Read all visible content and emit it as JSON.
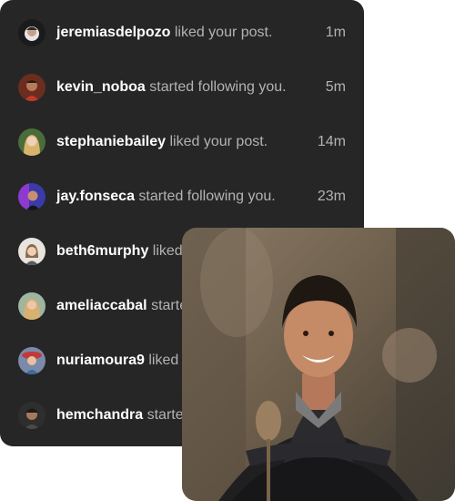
{
  "notifications": [
    {
      "username": "jeremiasdelpozo",
      "action": "liked your post.",
      "time": "1m"
    },
    {
      "username": "kevin_noboa",
      "action": "started following you.",
      "time": "5m"
    },
    {
      "username": "stephaniebailey",
      "action": "liked your post.",
      "time": "14m"
    },
    {
      "username": "jay.fonseca",
      "action": "started following you.",
      "time": "23m"
    },
    {
      "username": "beth6murphy",
      "action": "liked your post.",
      "time": ""
    },
    {
      "username": "ameliaccabal",
      "action": "started following you.",
      "time": ""
    },
    {
      "username": "nuriamoura9",
      "action": "liked your post.",
      "time": ""
    },
    {
      "username": "hemchandra",
      "action": "started following you.",
      "time": ""
    }
  ],
  "colors": {
    "panel_bg": "#262626",
    "username": "#ffffff",
    "secondary_text": "#b3b3b3"
  }
}
